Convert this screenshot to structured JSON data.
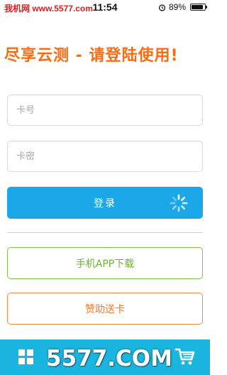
{
  "status_bar": {
    "carrier": "我机网 www.5577.com",
    "time": "11:54",
    "battery_percent": "89%",
    "battery_level": 0.89,
    "icons": [
      "alarm-icon",
      "battery-icon"
    ]
  },
  "headline": "尽享云测 - 请登陆使用!",
  "form": {
    "card_placeholder": "卡号",
    "password_placeholder": "卡密",
    "login_label": "登录"
  },
  "buttons": {
    "download_label": "手机APP下载",
    "gift_label": "赞助送卡"
  },
  "tab_bar": {
    "icons": [
      "grid-icon",
      "cart-icon"
    ]
  },
  "watermark": "5577.COM",
  "colors": {
    "accent_orange": "#ff6a10",
    "login_blue": "#1ba7e8",
    "download_green": "#6cb33a",
    "gift_orange": "#ef7a32",
    "tab_bar_cyan": "#1bb6e0"
  }
}
